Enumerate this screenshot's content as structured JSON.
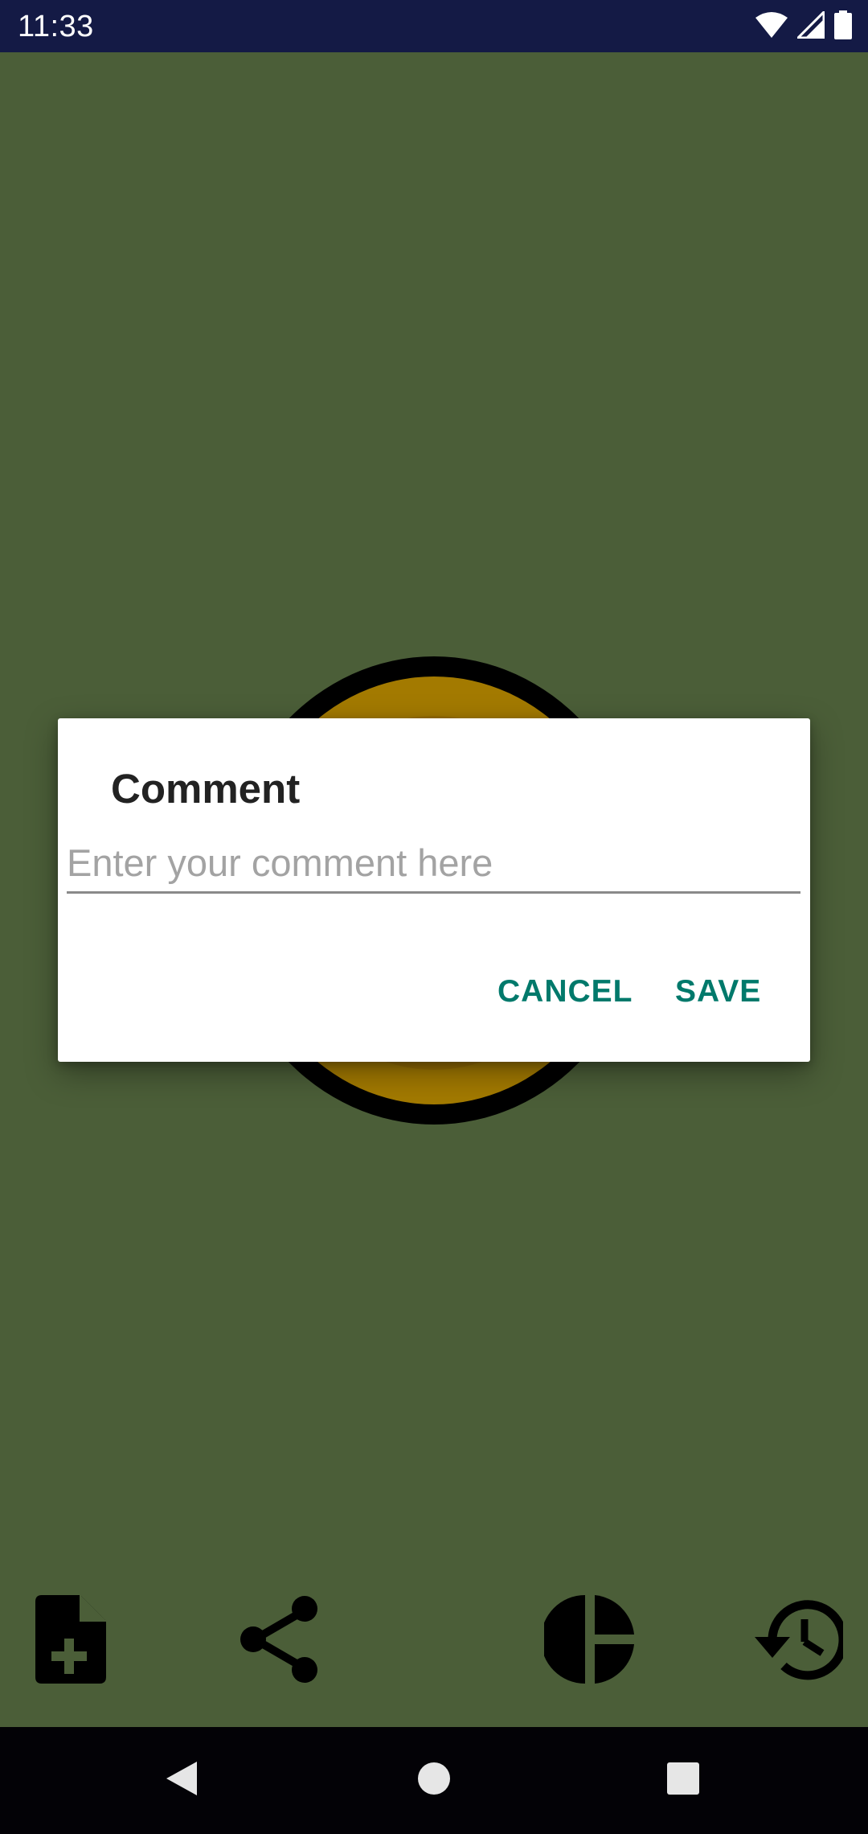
{
  "status_bar": {
    "time": "11:33",
    "icons": [
      "wifi-icon",
      "cell-signal-icon",
      "battery-icon"
    ]
  },
  "dialog": {
    "title": "Comment",
    "input_value": "",
    "input_placeholder": "Enter your comment here",
    "cancel_label": "CANCEL",
    "save_label": "SAVE"
  },
  "toolbar": {
    "items": [
      "new-file-icon",
      "share-icon",
      "pie-chart-icon",
      "history-icon"
    ]
  },
  "nav_bar": {
    "items": [
      "back-icon",
      "home-icon",
      "recents-icon"
    ]
  },
  "colors": {
    "status_bar": "#141a45",
    "background": "#4b5e38",
    "accent": "#00796b",
    "nav_bar": "#030206"
  }
}
